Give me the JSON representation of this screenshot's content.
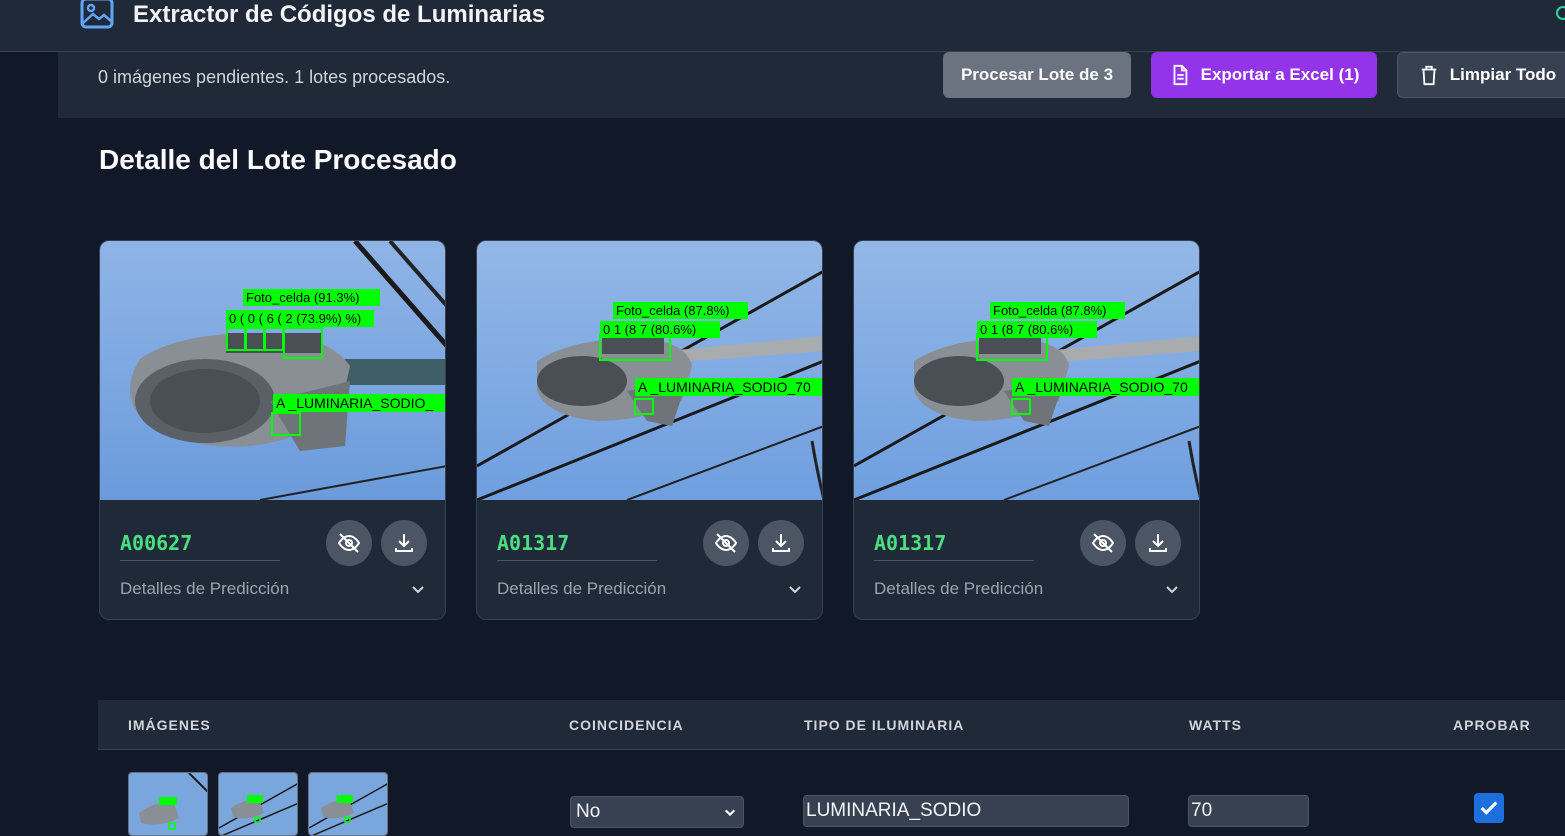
{
  "app": {
    "title": "Extractor de Códigos de Luminarias"
  },
  "status": {
    "text": "0 imágenes pendientes. 1 lotes procesados.",
    "process_label": "Procesar Lote de 3",
    "export_label": "Exportar a Excel (1)",
    "clear_label": "Limpiar Todo"
  },
  "section": {
    "title": "Detalle del Lote Procesado"
  },
  "cards": [
    {
      "code": "A00627",
      "details_label": "Detalles de Predicción",
      "labels": {
        "photocell": "Foto_celda (91.3%)",
        "digits": "0 ( 0 ( 6 ( 2 (73.9%) %)",
        "type": "A _LUMINARIA_SODIO_"
      }
    },
    {
      "code": "A01317",
      "details_label": "Detalles de Predicción",
      "labels": {
        "photocell": "Foto_celda (87.8%)",
        "digits": "0 1 (8 7 (80.6%)",
        "type": "A _LUMINARIA_SODIO_70"
      }
    },
    {
      "code": "A01317",
      "details_label": "Detalles de Predicción",
      "labels": {
        "photocell": "Foto_celda (87.8%)",
        "digits": "0 1 (8 7 (80.6%)",
        "type": "A _LUMINARIA_SODIO_70"
      }
    }
  ],
  "table": {
    "headers": [
      "IMÁGENES",
      "COINCIDENCIA",
      "TIPO DE ILUMINARIA",
      "WATTS",
      "APROBAR"
    ],
    "row": {
      "coincidence": "No",
      "type": "LUMINARIA_SODIO",
      "watts": "70",
      "approved": true
    }
  },
  "colors": {
    "accent": "#9333ea",
    "code": "#4ade80",
    "detect": "#00ff00",
    "sky": "#7aa6de"
  }
}
